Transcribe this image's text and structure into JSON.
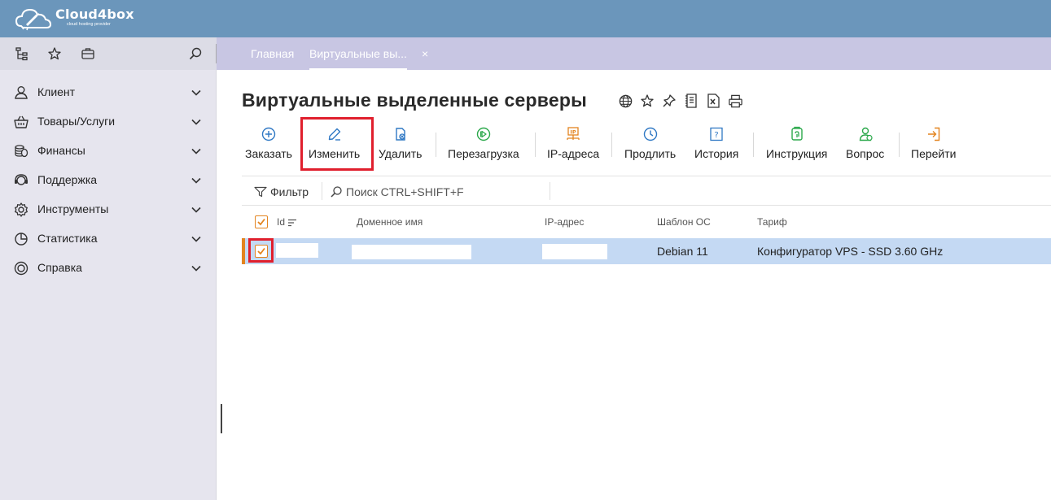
{
  "brand": {
    "name": "Cloud4box",
    "tagline": "cloud hosting provider"
  },
  "colors": {
    "header": "#6b96bb",
    "tabbar": "#c8c6e3",
    "sidebar": "#e6e5ee",
    "accent": "#e3841f",
    "selected_row": "#c4d9f3",
    "highlight": "#e01f2d"
  },
  "tabs": [
    {
      "label": "Главная",
      "active": false
    },
    {
      "label": "Виртуальные вы...",
      "active": true,
      "closable": true
    }
  ],
  "tab_close_glyph": "×",
  "nav_icons": [
    "tree-structure-icon",
    "star-icon",
    "briefcase-icon",
    "search-icon"
  ],
  "sidebar": {
    "items": [
      {
        "label": "Клиент",
        "icon": "user-icon"
      },
      {
        "label": "Товары/Услуги",
        "icon": "basket-icon"
      },
      {
        "label": "Финансы",
        "icon": "coins-icon"
      },
      {
        "label": "Поддержка",
        "icon": "support-icon"
      },
      {
        "label": "Инструменты",
        "icon": "gear-icon"
      },
      {
        "label": "Статистика",
        "icon": "pie-chart-icon"
      },
      {
        "label": "Справка",
        "icon": "lifebuoy-icon"
      }
    ]
  },
  "page": {
    "title": "Виртуальные выделенные серверы"
  },
  "title_icons": [
    "globe-icon",
    "star-icon",
    "pin-icon",
    "document-icon",
    "excel-icon",
    "print-icon"
  ],
  "toolbar": [
    {
      "label": "Заказать",
      "icon": "plus-circle-icon"
    },
    {
      "label": "Изменить",
      "icon": "pencil-icon"
    },
    {
      "label": "Удалить",
      "icon": "delete-icon"
    },
    {
      "label": "Перезагрузка",
      "icon": "restart-icon"
    },
    {
      "label": "IP-адреса",
      "icon": "ip-icon"
    },
    {
      "label": "Продлить",
      "icon": "clock-icon"
    },
    {
      "label": "История",
      "icon": "history-icon"
    },
    {
      "label": "Инструкция",
      "icon": "instruction-icon"
    },
    {
      "label": "Вопрос",
      "icon": "question-user-icon"
    },
    {
      "label": "Перейти",
      "icon": "goto-icon"
    }
  ],
  "filter": {
    "label": "Фильтр",
    "search_placeholder": "Поиск CTRL+SHIFT+F"
  },
  "table": {
    "columns": [
      "Id",
      "Доменное имя",
      "IP-адрес",
      "Шаблон ОС",
      "Тариф"
    ],
    "rows": [
      {
        "id": "",
        "domain": "",
        "ip": "",
        "os": "Debian 11",
        "tariff": "Конфигуратор VPS - SSD 3.60 GHz",
        "checked": true
      }
    ]
  }
}
